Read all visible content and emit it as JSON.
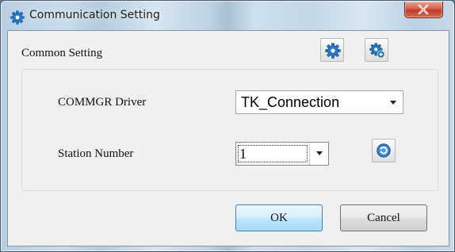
{
  "window": {
    "title": "Communication Setting",
    "title_icon": "gear-icon",
    "close_icon": "close-icon"
  },
  "toolbar": {
    "settings_icon": "gear-icon",
    "advanced_settings_icon": "gear-plus-icon"
  },
  "group": {
    "header": "Common Setting"
  },
  "fields": {
    "driver_label": "COMMGR Driver",
    "driver_value": "TK_Connection",
    "station_label": "Station Number",
    "station_value": "1",
    "refresh_icon": "refresh-icon"
  },
  "buttons": {
    "ok": "OK",
    "cancel": "Cancel"
  },
  "colors": {
    "accent": "#3c7fb1",
    "icon_blue": "#2b78c2",
    "close_red": "#c0392b"
  }
}
